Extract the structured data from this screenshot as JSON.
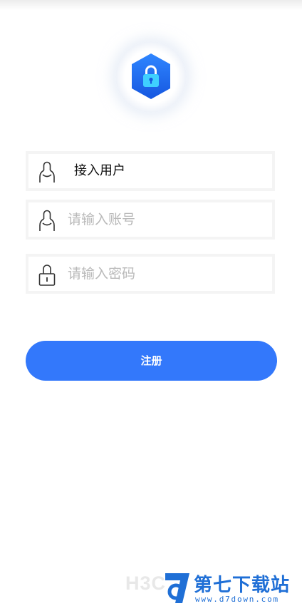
{
  "app": {
    "logo_icon": "shield-lock-icon",
    "accent_color": "#3378fb"
  },
  "form": {
    "access_user": {
      "icon": "user-icon",
      "value": "接入用户"
    },
    "account": {
      "icon": "user-icon",
      "placeholder": "请输入账号"
    },
    "password": {
      "icon": "lock-icon",
      "placeholder": "请输入密码"
    },
    "register_label": "注册"
  },
  "watermark": {
    "brand": "H3C",
    "site_title": "第七下载站",
    "site_url": "www.d7down.com"
  }
}
